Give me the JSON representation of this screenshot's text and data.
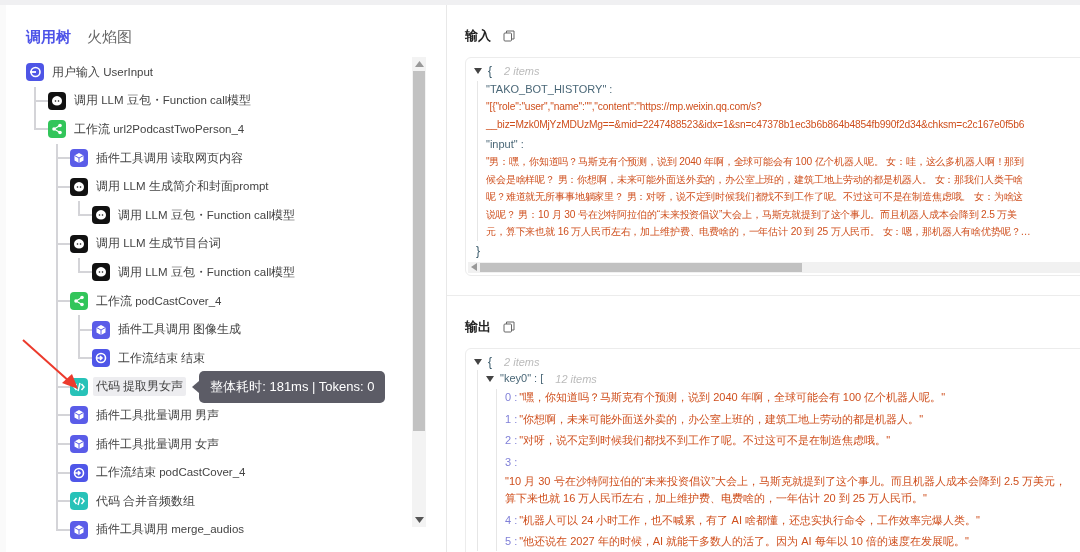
{
  "tabs": [
    {
      "label": "调用树",
      "selected": true
    },
    {
      "label": "火焰图",
      "selected": false
    }
  ],
  "tree": [
    {
      "kind": "input",
      "label": "用户输入 UserInput",
      "selected": false,
      "children": [
        {
          "kind": "llm",
          "label": "调用 LLM 豆包・Function call模型",
          "selected": false
        },
        {
          "kind": "workflow",
          "label": "工作流 url2PodcastTwoPerson_4",
          "selected": false,
          "children": [
            {
              "kind": "plugin",
              "label": "插件工具调用 读取网页内容",
              "selected": false
            },
            {
              "kind": "llm",
              "label": "调用 LLM 生成简介和封面prompt",
              "selected": false,
              "children": [
                {
                  "kind": "llm",
                  "label": "调用 LLM 豆包・Function call模型",
                  "selected": false
                }
              ]
            },
            {
              "kind": "llm",
              "label": "调用 LLM 生成节目台词",
              "selected": false,
              "children": [
                {
                  "kind": "llm",
                  "label": "调用 LLM 豆包・Function call模型",
                  "selected": false
                }
              ]
            },
            {
              "kind": "workflow",
              "label": "工作流 podCastCover_4",
              "selected": false,
              "children": [
                {
                  "kind": "plugin",
                  "label": "插件工具调用 图像生成",
                  "selected": false
                },
                {
                  "kind": "end",
                  "label": "工作流结束 结束",
                  "selected": false
                }
              ]
            },
            {
              "kind": "code",
              "label": "代码 提取男女声",
              "selected": true
            },
            {
              "kind": "plugin",
              "label": "插件工具批量调用 男声",
              "selected": false
            },
            {
              "kind": "plugin",
              "label": "插件工具批量调用 女声",
              "selected": false
            },
            {
              "kind": "end",
              "label": "工作流结束 podCastCover_4",
              "selected": false
            },
            {
              "kind": "code",
              "label": "代码 合并音频数组",
              "selected": false
            },
            {
              "kind": "plugin",
              "label": "插件工具调用 merge_audios",
              "selected": false
            }
          ]
        }
      ]
    }
  ],
  "tooltip": "整体耗时: 181ms | Tokens: 0",
  "input_panel": {
    "title": "输入",
    "open": "{",
    "count": "2 items",
    "close": "}",
    "expanded": true,
    "entries": [
      {
        "key": "\"TAKO_BOT_HISTORY\" :",
        "value_lines": [
          "\"[{\"role\":\"user\",\"name\":\"\",\"content\":\"https://mp.weixin.qq.com/s?",
          "__biz=Mzk0MjYzMDUzMg==&mid=2247488523&idx=1&sn=c47378b1ec3b6b864b4854fb990f2d34&chksm=c2c167e0f5b6"
        ]
      },
      {
        "key": "\"input\" :",
        "value_lines": [
          "\"男：嘿，你知道吗？马斯克有个预测，说到 2040 年啊，全球可能会有 100 亿个机器人呢。 女：哇，这么多机器人啊！那到",
          "候会是啥样呢？ 男：你想啊，未来可能外面送外卖的，办公室上班的，建筑工地上劳动的都是机器人。 女：那我们人类干啥",
          "呢？难道就无所事事地躺家里？ 男：对呀，说不定到时候我们都找不到工作了呢。不过这可不是在制造焦虑哦。 女：为啥这",
          "说呢？ 男：10 月 30 号在沙特阿拉伯的“未来投资倡议”大会上，马斯克就提到了这个事儿。而且机器人成本会降到 2.5 万美",
          "元，算下来也就 16 万人民币左右，加上维护费、电费啥的，一年估计 20 到 25 万人民币。 女：嗯，那机器人有啥优势呢？…"
        ]
      }
    ]
  },
  "output_panel": {
    "title": "输出",
    "open": "{",
    "count": "2 items",
    "expanded": true,
    "entries": [
      {
        "key": "\"key0\" : [",
        "count": "12 items",
        "expanded": true,
        "items": [
          {
            "index": "0 :",
            "value_lines": [
              "\"嘿，你知道吗？马斯克有个预测，说到 2040 年啊，全球可能会有 100 亿个机器人呢。\""
            ]
          },
          {
            "index": "1 :",
            "value_lines": [
              "\"你想啊，未来可能外面送外卖的，办公室上班的，建筑工地上劳动的都是机器人。\""
            ]
          },
          {
            "index": "2 :",
            "value_lines": [
              "\"对呀，说不定到时候我们都找不到工作了呢。不过这可不是在制造焦虑哦。\""
            ]
          },
          {
            "index": "3 :",
            "value_lines": [
              "\"10 月 30 号在沙特阿拉伯的“未来投资倡议”大会上，马斯克就提到了这个事儿。而且机器人成本会降到 2.5 万美元，",
              "算下来也就 16 万人民币左右，加上维护费、电费啥的，一年估计 20 到 25 万人民币。\""
            ]
          },
          {
            "index": "4 :",
            "value_lines": [
              "\"机器人可以 24 小时工作，也不喊累，有了 AI 啥都懂，还忠实执行命令，工作效率完爆人类。\""
            ]
          },
          {
            "index": "5 :",
            "value_lines": [
              "\"他还说在 2027 年的时候，AI 就能干多数人的活了。因为 AI 每年以 10 倍的速度在发展呢。\""
            ]
          }
        ]
      }
    ]
  }
}
